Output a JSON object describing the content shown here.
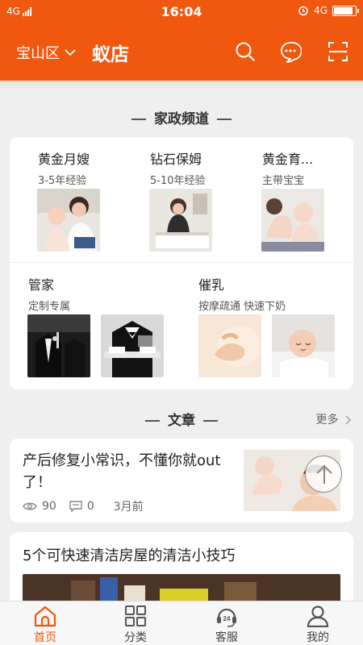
{
  "colors": {
    "accent": "#f0580f",
    "background": "#efefef",
    "card": "#ffffff"
  },
  "status_bar": {
    "network": "4G",
    "time": "16:04",
    "network_right": "4G",
    "battery_percent": 90
  },
  "header": {
    "location": "宝山区",
    "brand": "蚁店",
    "icons": [
      "search-icon",
      "chat-icon",
      "scan-icon"
    ]
  },
  "services": {
    "section_title": "家政频道",
    "items": [
      {
        "title": "黄金月嫂",
        "subtitle": "3-5年经验"
      },
      {
        "title": "钻石保姆",
        "subtitle": "5-10年经验"
      },
      {
        "title": "黄金育...",
        "subtitle": "主带宝宝"
      },
      {
        "title": "管家",
        "subtitle": "定制专属"
      },
      {
        "title": "催乳",
        "subtitle": "按摩疏通 快速下奶"
      }
    ]
  },
  "articles": {
    "section_title": "文章",
    "more_label": "更多",
    "items": [
      {
        "title": "产后修复小常识，不懂你就out了！",
        "views": "90",
        "comments": "0",
        "time": "3月前"
      },
      {
        "title": "5个可快速清洁房屋的清洁小技巧"
      }
    ]
  },
  "tabbar": {
    "items": [
      {
        "label": "首页",
        "icon": "home-icon",
        "active": true
      },
      {
        "label": "分类",
        "icon": "grid-icon"
      },
      {
        "label": "客服",
        "icon": "support-24-icon"
      },
      {
        "label": "我的",
        "icon": "user-icon"
      }
    ]
  }
}
